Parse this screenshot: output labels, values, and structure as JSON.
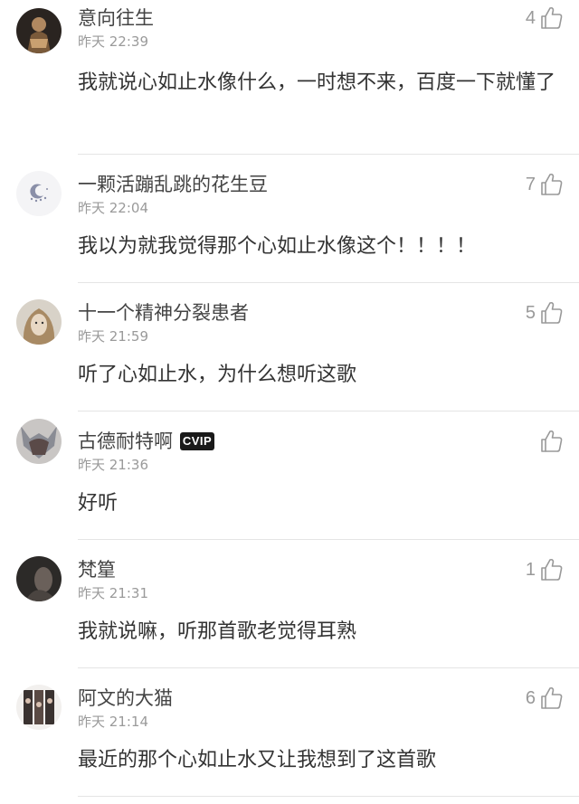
{
  "comments": [
    {
      "user": "意向往生",
      "time": "昨天 22:39",
      "text": "我就说心如止水像什么，一时想不来，百度一下就懂了",
      "likes": "4",
      "vip": false,
      "avatar": "avatar-warrior"
    },
    {
      "user": "一颗活蹦乱跳的花生豆",
      "time": "昨天 22:04",
      "text": "我以为就我觉得那个心如止水像这个！！！！",
      "likes": "7",
      "vip": false,
      "avatar": "avatar-moon-stars"
    },
    {
      "user": "十一个精神分裂患者",
      "time": "昨天 21:59",
      "text": "听了心如止水，为什么想听这歌",
      "likes": "5",
      "vip": false,
      "avatar": "avatar-face"
    },
    {
      "user": "古德耐特啊",
      "time": "昨天 21:36",
      "text": "好听",
      "likes": "",
      "vip": true,
      "vip_label": "CVIP",
      "avatar": "avatar-helmet"
    },
    {
      "user": "梵篂",
      "time": "昨天 21:31",
      "text": "我就说嘛，听那首歌老觉得耳熟",
      "likes": "1",
      "vip": false,
      "avatar": "avatar-dark-portrait"
    },
    {
      "user": "阿文的大猫",
      "time": "昨天 21:14",
      "text": "最近的那个心如止水又让我想到了这首歌",
      "likes": "6",
      "vip": false,
      "avatar": "avatar-photo-strip"
    }
  ],
  "icons": {
    "like": "thumbs-up-icon"
  },
  "colors": {
    "name": "#444444",
    "time": "#9a9a9a",
    "text": "#333333",
    "like": "#999999",
    "divider": "#e5e5e5"
  }
}
